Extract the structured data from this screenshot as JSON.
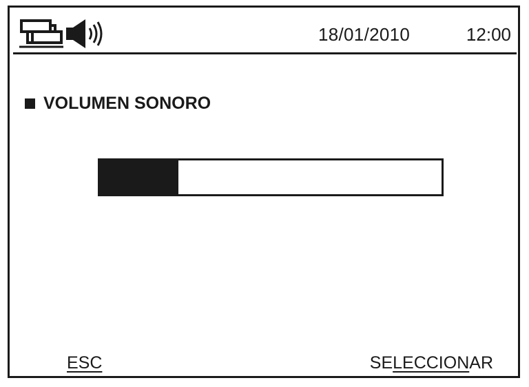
{
  "status_bar": {
    "icons": [
      "network-icon",
      "speaker-icon"
    ],
    "date": "18/01/2010",
    "time": "12:00"
  },
  "section": {
    "title": "VOLUMEN SONORO"
  },
  "volume": {
    "level": 0.23
  },
  "softkeys": {
    "left_label": "ESC",
    "right_label": {
      "part1": "SE",
      "part2": "LECCION",
      "part3": "AR"
    }
  },
  "colors": {
    "ink": "#1a1a1a",
    "background": "#ffffff"
  }
}
